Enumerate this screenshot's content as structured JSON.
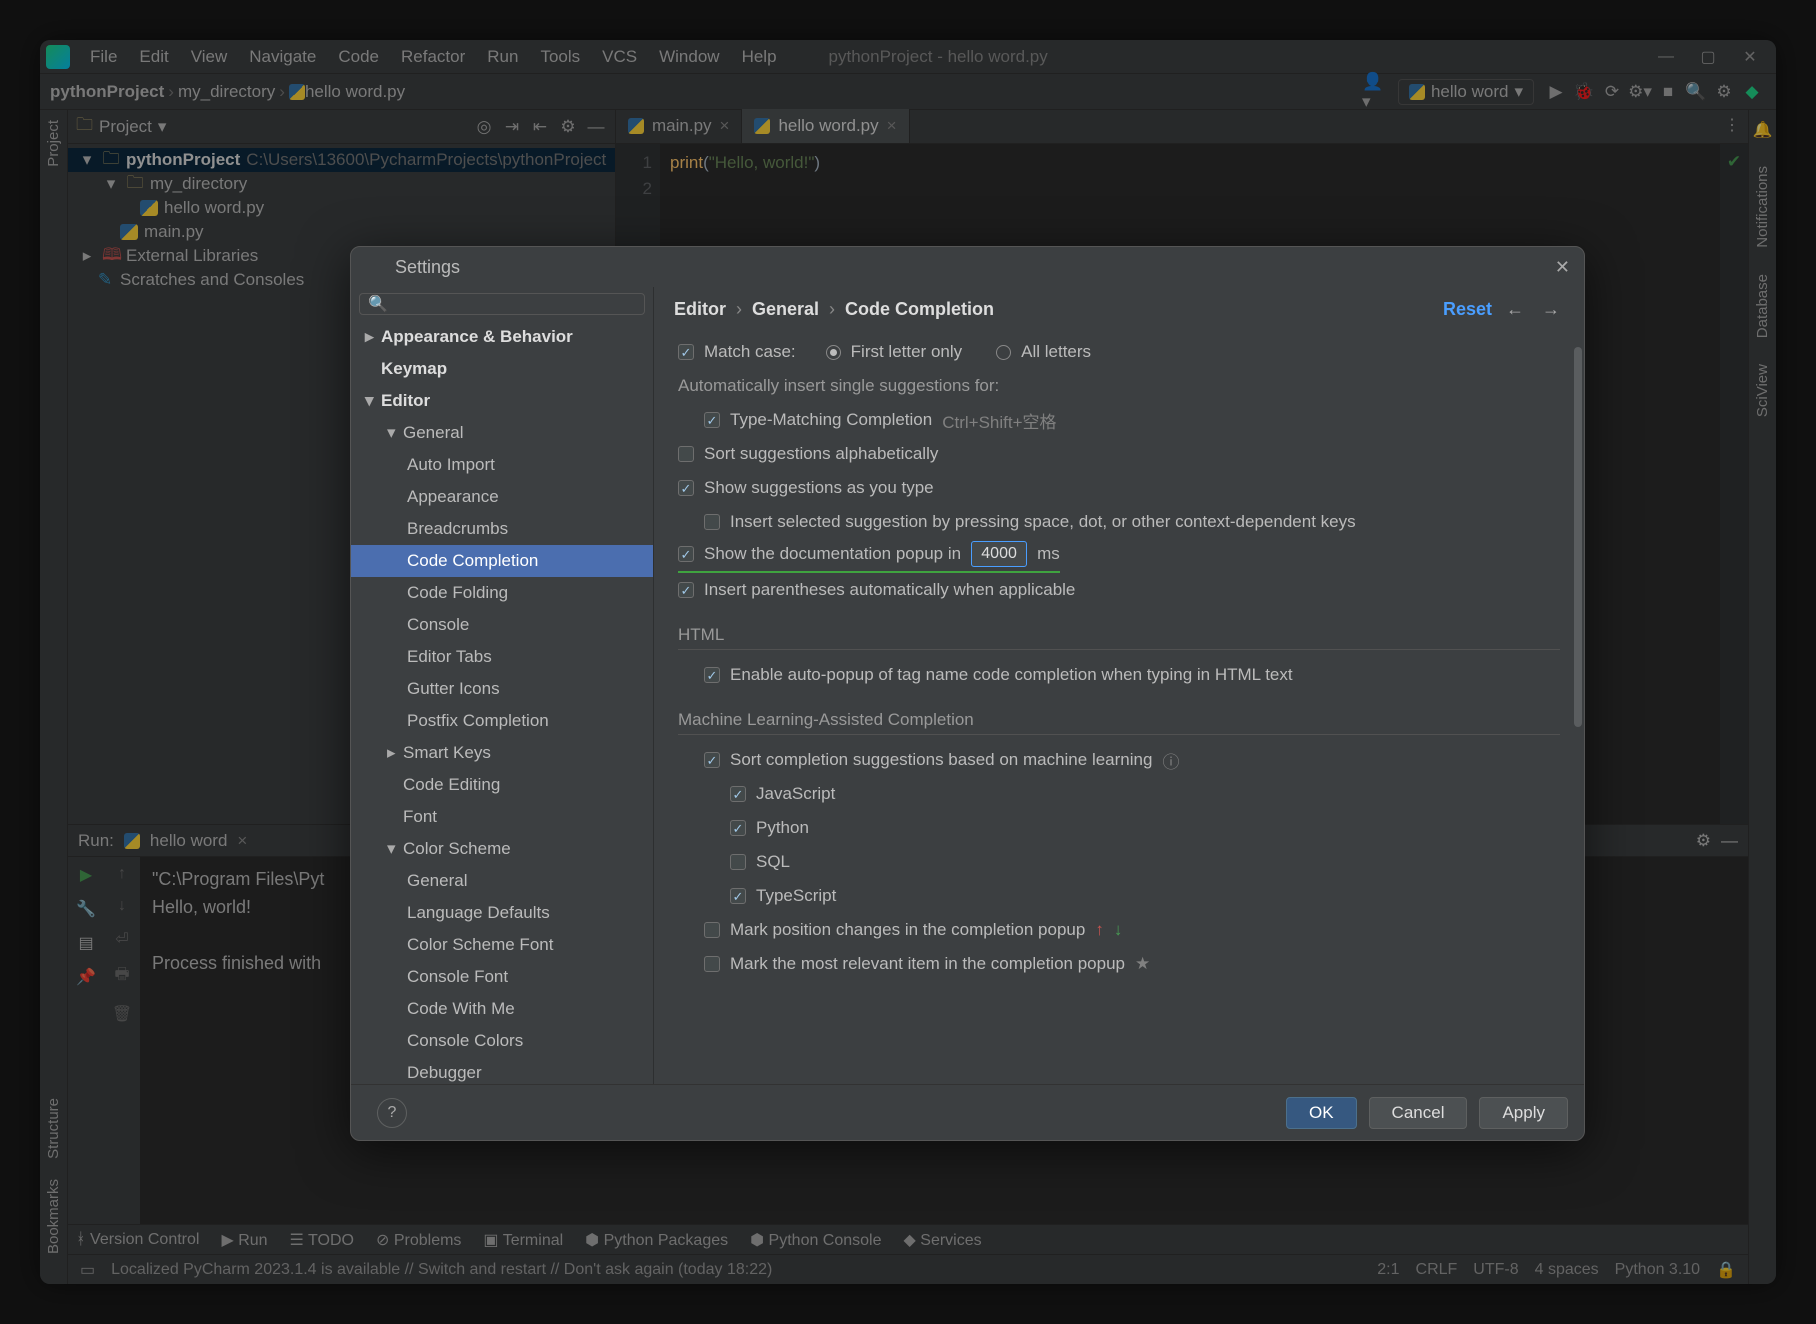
{
  "menubar": {
    "items": [
      "File",
      "Edit",
      "View",
      "Navigate",
      "Code",
      "Refactor",
      "Run",
      "Tools",
      "VCS",
      "Window",
      "Help"
    ],
    "title": "pythonProject - hello word.py"
  },
  "breadcrumb": {
    "project": "pythonProject",
    "dir": "my_directory",
    "file": "hello word.py"
  },
  "runconfig": {
    "name": "hello word"
  },
  "project_pane": {
    "title": "Project",
    "nodes": {
      "root": "pythonProject",
      "root_path": "C:\\Users\\13600\\PycharmProjects\\pythonProject",
      "dir": "my_directory",
      "file1": "hello word.py",
      "file2": "main.py",
      "ext": "External Libraries",
      "scratch": "Scratches and Consoles"
    }
  },
  "tabs": {
    "t1": "main.py",
    "t2": "hello word.py"
  },
  "editor": {
    "line1_fn": "print",
    "line1_paren_open": "(",
    "line1_str": "\"Hello, world!\"",
    "line1_paren_close": ")",
    "gutter1": "1",
    "gutter2": "2"
  },
  "run_panel": {
    "label": "Run:",
    "target": "hello word",
    "out1": "\"C:\\Program Files\\Pyt",
    "out2": "Hello, world!",
    "out3": "Process finished with"
  },
  "bottom_tabs": {
    "vc": "Version Control",
    "run": "Run",
    "todo": "TODO",
    "problems": "Problems",
    "terminal": "Terminal",
    "pkg": "Python Packages",
    "console": "Python Console",
    "services": "Services"
  },
  "statusbar": {
    "msg": "Localized PyCharm 2023.1.4 is available // Switch and restart // Don't ask again (today 18:22)",
    "pos": "2:1",
    "sep": "CRLF",
    "enc": "UTF-8",
    "indent": "4 spaces",
    "interp": "Python 3.10"
  },
  "right_tools": {
    "notifications": "Notifications",
    "database": "Database",
    "sciview": "SciView"
  },
  "left_tools": {
    "project": "Project",
    "structure": "Structure",
    "bookmarks": "Bookmarks"
  },
  "settings": {
    "title": "Settings",
    "search_placeholder": "",
    "tree": {
      "appearance": "Appearance & Behavior",
      "keymap": "Keymap",
      "editor": "Editor",
      "general": "General",
      "auto_import": "Auto Import",
      "appearance2": "Appearance",
      "breadcrumbs": "Breadcrumbs",
      "code_completion": "Code Completion",
      "code_folding": "Code Folding",
      "console": "Console",
      "editor_tabs": "Editor Tabs",
      "gutter": "Gutter Icons",
      "postfix": "Postfix Completion",
      "smart_keys": "Smart Keys",
      "code_editing": "Code Editing",
      "font": "Font",
      "color_scheme": "Color Scheme",
      "cs_general": "General",
      "cs_lang": "Language Defaults",
      "cs_font": "Color Scheme Font",
      "cs_console": "Console Font",
      "cs_cwm": "Code With Me",
      "cs_cc": "Console Colors",
      "cs_dbg": "Debugger"
    },
    "crumb": {
      "a": "Editor",
      "b": "General",
      "c": "Code Completion",
      "reset": "Reset"
    },
    "content": {
      "match_case": "Match case:",
      "first_letter": "First letter only",
      "all_letters": "All letters",
      "auto_insert": "Automatically insert single suggestions for:",
      "type_match": "Type-Matching Completion",
      "type_match_hint": "Ctrl+Shift+空格",
      "sort_alpha": "Sort suggestions alphabetically",
      "show_suggest": "Show suggestions as you type",
      "insert_selected": "Insert selected suggestion by pressing space, dot, or other context-dependent keys",
      "show_doc_pre": "Show the documentation popup in",
      "show_doc_val": "4000",
      "show_doc_post": "ms",
      "insert_paren": "Insert parentheses automatically when applicable",
      "html_h": "HTML",
      "html_enable": "Enable auto-popup of tag name code completion when typing in HTML text",
      "ml_h": "Machine Learning-Assisted Completion",
      "ml_sort": "Sort completion suggestions based on machine learning",
      "ml_js": "JavaScript",
      "ml_py": "Python",
      "ml_sql": "SQL",
      "ml_ts": "TypeScript",
      "mark_pos": "Mark position changes in the completion popup",
      "mark_rel": "Mark the most relevant item in the completion popup"
    },
    "buttons": {
      "ok": "OK",
      "cancel": "Cancel",
      "apply": "Apply"
    }
  }
}
